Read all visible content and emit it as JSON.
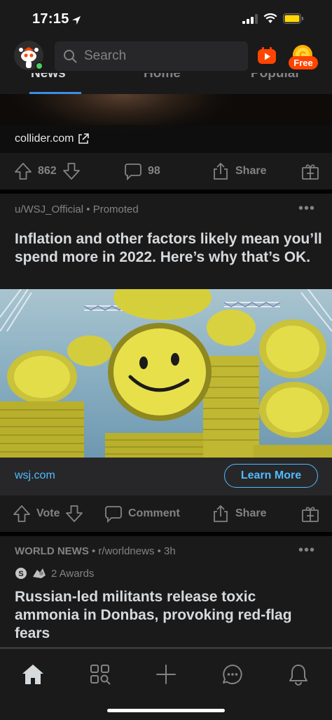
{
  "status_bar": {
    "time": "17:15"
  },
  "header": {
    "search_placeholder": "Search",
    "free_badge": "Free",
    "colors": {
      "accent": "#ff4500",
      "online": "#46d160",
      "link": "#4fbcff"
    }
  },
  "tabs": [
    {
      "label": "News",
      "active": true
    },
    {
      "label": "Home",
      "active": false
    },
    {
      "label": "Popular",
      "active": false
    }
  ],
  "post1": {
    "link_domain": "collider.com",
    "upvotes": "862",
    "comments": "98",
    "share_label": "Share"
  },
  "post2": {
    "author": "u/WSJ_Official",
    "tag": "Promoted",
    "title": "Inflation and other factors likely mean you’ll spend more in 2022. Here’s why that’s OK.",
    "link_domain": "wsj.com",
    "cta": "Learn More",
    "vote_label": "Vote",
    "comment_label": "Comment",
    "share_label": "Share"
  },
  "post3": {
    "community_label": "WORLD NEWS",
    "subreddit": "r/worldnews",
    "age": "3h",
    "awards": "2 Awards",
    "title": "Russian-led militants release toxic ammonia in Donbas, provoking red-flag fears"
  },
  "bottom_nav": [
    "home-icon",
    "discover-icon",
    "create-icon",
    "chat-icon",
    "notifications-icon"
  ]
}
